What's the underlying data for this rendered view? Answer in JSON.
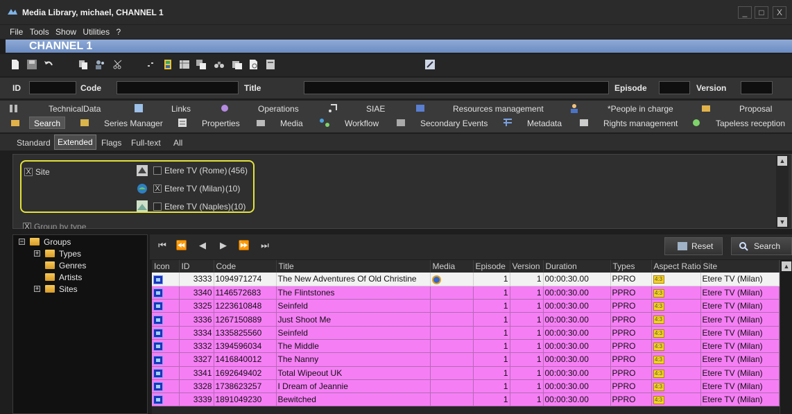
{
  "window": {
    "title": "Media Library, michael, CHANNEL 1",
    "controls": [
      "_",
      "□",
      "X"
    ]
  },
  "menu": [
    "File",
    "Tools",
    "Show",
    "Utilities",
    "?"
  ],
  "channel": "CHANNEL 1",
  "fields": {
    "id_label": "ID",
    "code_label": "Code",
    "title_label": "Title",
    "episode_label": "Episode",
    "version_label": "Version"
  },
  "tabs_row1": [
    "TechnicalData",
    "Links",
    "Operations",
    "SIAE",
    "Resources management",
    "*People in charge",
    "Proposal"
  ],
  "tabs_row2": [
    "Search",
    "Series Manager",
    "Properties",
    "Media",
    "Workflow",
    "Secondary Events",
    "Metadata",
    "Rights management",
    "Tapeless reception"
  ],
  "subtabs": [
    "Standard",
    "Extended",
    "Flags",
    "Full-text",
    "All"
  ],
  "filter": {
    "site_label": "Site",
    "site_checked": "X",
    "sites": [
      {
        "label": "Etere TV (Rome)",
        "count": "(456)",
        "checked": ""
      },
      {
        "label": "Etere TV (Milan)",
        "count": "(10)",
        "checked": "X"
      },
      {
        "label": "Etere TV (Naples)",
        "count": "(10)",
        "checked": ""
      }
    ],
    "group_by_type": "Group by type"
  },
  "tree": {
    "root": "Groups",
    "children": [
      "Types",
      "Genres",
      "Artists",
      "Sites"
    ]
  },
  "buttons": {
    "reset": "Reset",
    "search": "Search"
  },
  "table": {
    "columns": [
      "Icon",
      "ID",
      "Code",
      "Title",
      "Media",
      "Episode",
      "Version",
      "Duration",
      "Types",
      "Aspect Ratio",
      "Site"
    ],
    "rows": [
      {
        "id": "3333",
        "code": "1094971274",
        "title": "The New Adventures Of Old Christine",
        "episode": "1",
        "version": "1",
        "duration": "00:00:30.00",
        "type": "PPRO",
        "aspect": "4:3",
        "site": "Etere TV (Milan)"
      },
      {
        "id": "3340",
        "code": "1146572683",
        "title": "The Flintstones",
        "episode": "1",
        "version": "1",
        "duration": "00:00:30.00",
        "type": "PPRO",
        "aspect": "4:3",
        "site": "Etere TV (Milan)"
      },
      {
        "id": "3325",
        "code": "1223610848",
        "title": "Seinfeld",
        "episode": "1",
        "version": "1",
        "duration": "00:00:30.00",
        "type": "PPRO",
        "aspect": "4:3",
        "site": "Etere TV (Milan)"
      },
      {
        "id": "3336",
        "code": "1267150889",
        "title": "Just Shoot Me",
        "episode": "1",
        "version": "1",
        "duration": "00:00:30.00",
        "type": "PPRO",
        "aspect": "4:3",
        "site": "Etere TV (Milan)"
      },
      {
        "id": "3334",
        "code": "1335825560",
        "title": "Seinfeld",
        "episode": "1",
        "version": "1",
        "duration": "00:00:30.00",
        "type": "PPRO",
        "aspect": "4:3",
        "site": "Etere TV (Milan)"
      },
      {
        "id": "3332",
        "code": "1394596034",
        "title": "The Middle",
        "episode": "1",
        "version": "1",
        "duration": "00:00:30.00",
        "type": "PPRO",
        "aspect": "4:3",
        "site": "Etere TV (Milan)"
      },
      {
        "id": "3327",
        "code": "1416840012",
        "title": "The Nanny",
        "episode": "1",
        "version": "1",
        "duration": "00:00:30.00",
        "type": "PPRO",
        "aspect": "4:3",
        "site": "Etere TV (Milan)"
      },
      {
        "id": "3341",
        "code": "1692649402",
        "title": "Total Wipeout UK",
        "episode": "1",
        "version": "1",
        "duration": "00:00:30.00",
        "type": "PPRO",
        "aspect": "4:3",
        "site": "Etere TV (Milan)"
      },
      {
        "id": "3328",
        "code": "1738623257",
        "title": "I Dream of Jeannie",
        "episode": "1",
        "version": "1",
        "duration": "00:00:30.00",
        "type": "PPRO",
        "aspect": "4:3",
        "site": "Etere TV (Milan)"
      },
      {
        "id": "3339",
        "code": "1891049230",
        "title": "Bewitched",
        "episode": "1",
        "version": "1",
        "duration": "00:00:30.00",
        "type": "PPRO",
        "aspect": "4:3",
        "site": "Etere TV (Milan)"
      }
    ]
  },
  "colors": {
    "row_highlight": "#f57ef5",
    "selected_row": "#f2f2f2",
    "filter_outline": "#e3e33a",
    "channel_bar": "#8faad6"
  }
}
